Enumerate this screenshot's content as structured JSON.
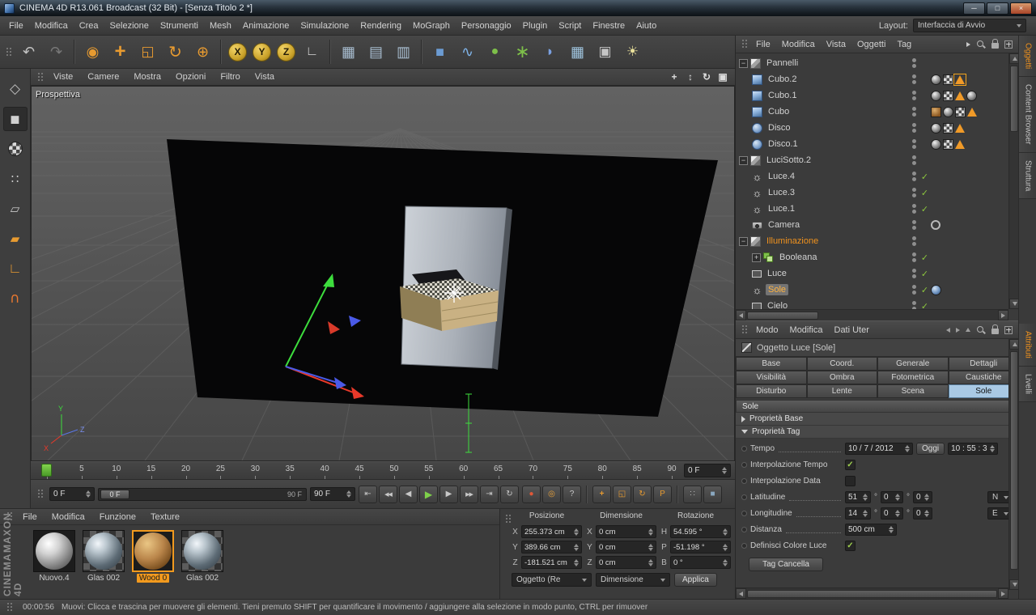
{
  "window": {
    "title": "CINEMA 4D R13.061 Broadcast (32 Bit) - [Senza Titolo 2 *]",
    "minimize": "─",
    "maximize": "□",
    "close": "×"
  },
  "menubar": {
    "items": [
      "File",
      "Modifica",
      "Crea",
      "Selezione",
      "Strumenti",
      "Mesh",
      "Animazione",
      "Simulazione",
      "Rendering",
      "MoGraph",
      "Personaggio",
      "Plugin",
      "Script",
      "Finestre",
      "Aiuto"
    ],
    "layout_label": "Layout:",
    "layout_value": "Interfaccia di Avvio"
  },
  "toolbar": {
    "icons": [
      {
        "name": "undo",
        "glyph": "↶",
        "color": "#c2c2c2",
        "size": 18
      },
      {
        "name": "redo",
        "glyph": "↷",
        "color": "#787878",
        "size": 18
      },
      {
        "sep": true
      },
      {
        "name": "live-selection",
        "glyph": "◉",
        "color": "#e89b30",
        "size": 18
      },
      {
        "name": "move-tool",
        "glyph": "+",
        "color": "#e89b30",
        "size": 24,
        "bold": true
      },
      {
        "name": "scale-tool",
        "glyph": "◱",
        "color": "#e89b30",
        "size": 17
      },
      {
        "name": "rotate-tool",
        "glyph": "↻",
        "color": "#e89b30",
        "size": 20
      },
      {
        "name": "last-tool",
        "glyph": "⊕",
        "color": "#e89b30",
        "size": 18
      },
      {
        "sep": true
      },
      {
        "name": "lock-x-axis",
        "glyph": "X",
        "color": "#241c06",
        "round": true
      },
      {
        "name": "lock-y-axis",
        "glyph": "Y",
        "color": "#241c06",
        "round": true
      },
      {
        "name": "lock-z-axis",
        "glyph": "Z",
        "color": "#241c06",
        "round": true
      },
      {
        "name": "coordinate-system",
        "glyph": "∟",
        "color": "#d8d8d8",
        "size": 16
      },
      {
        "sep": true
      },
      {
        "name": "render-view",
        "glyph": "▦",
        "color": "#a8bdd0",
        "size": 18
      },
      {
        "name": "render-picture-viewer",
        "glyph": "▤",
        "color": "#a8bdd0",
        "size": 18
      },
      {
        "name": "render-settings",
        "glyph": "▥",
        "color": "#a8bdd0",
        "size": 18
      },
      {
        "sep": true
      },
      {
        "name": "add-cube",
        "glyph": "■",
        "color": "#6b9bd2",
        "size": 18
      },
      {
        "name": "add-spline",
        "glyph": "∿",
        "color": "#7fb3e8",
        "size": 18
      },
      {
        "name": "add-generator",
        "glyph": "●",
        "color": "#7ec04a",
        "size": 16
      },
      {
        "name": "add-mograph",
        "glyph": "∗",
        "color": "#7ec04a",
        "size": 22
      },
      {
        "name": "add-deformer",
        "glyph": "◗",
        "color": "#7aa0e0",
        "size": 17
      },
      {
        "name": "add-environment",
        "glyph": "▦",
        "color": "#9fc4de",
        "size": 18
      },
      {
        "name": "add-camera",
        "glyph": "▣",
        "color": "#c4c4c4",
        "size": 17
      },
      {
        "name": "add-light",
        "glyph": "☀",
        "color": "#e8df9a",
        "size": 17
      }
    ]
  },
  "left_toolbar": {
    "icons": [
      {
        "name": "make-editable",
        "glyph": "◇",
        "color": "#c0c0c0",
        "size": 17
      },
      {
        "name": "model-mode",
        "glyph": "◼",
        "color": "#d0d0d0",
        "size": 15,
        "active": true
      },
      {
        "name": "texture-mode",
        "checker": true
      },
      {
        "name": "points-mode",
        "glyph": "∷",
        "color": "#c8c8c8",
        "size": 15
      },
      {
        "name": "edges-mode",
        "glyph": "▱",
        "color": "#c8c8c8",
        "size": 15
      },
      {
        "name": "polygons-mode",
        "glyph": "▰",
        "color": "#e89b30",
        "size": 15
      },
      {
        "name": "axis-mode",
        "glyph": "∟",
        "color": "#e89b30",
        "size": 17
      },
      {
        "name": "snap-tool",
        "glyph": "∪",
        "color": "#e87830",
        "size": 17,
        "rotate": true
      }
    ]
  },
  "viewport": {
    "label": "Prospettiva",
    "menus": [
      "Viste",
      "Camere",
      "Mostra",
      "Opzioni",
      "Filtro",
      "Vista"
    ],
    "nav": [
      {
        "name": "pan-view",
        "glyph": "+"
      },
      {
        "name": "dolly-view",
        "glyph": "↕"
      },
      {
        "name": "orbit-view",
        "glyph": "↻"
      },
      {
        "name": "toggle-view",
        "glyph": "▣"
      }
    ],
    "axis": {
      "x": "X",
      "y": "Y",
      "z": "Z"
    }
  },
  "timeline": {
    "frames": [
      0,
      5,
      10,
      15,
      20,
      25,
      30,
      35,
      40,
      45,
      50,
      55,
      60,
      65,
      70,
      75,
      80,
      85,
      90
    ],
    "current_frame": "0 F"
  },
  "animation": {
    "start_frame": "0 F",
    "slider_handle": "0 F",
    "slider_end": "90 F",
    "end_frame": "90 F",
    "transport": [
      {
        "name": "goto-start",
        "glyph": "⇤"
      },
      {
        "name": "previous-key",
        "glyph": "◀◀",
        "small": true
      },
      {
        "name": "previous-frame",
        "glyph": "◀"
      },
      {
        "name": "play",
        "glyph": "▶",
        "green": true
      },
      {
        "name": "next-frame",
        "glyph": "▶"
      },
      {
        "name": "next-key",
        "glyph": "▶▶",
        "small": true
      },
      {
        "name": "goto-end",
        "glyph": "⇥"
      },
      {
        "name": "loop",
        "glyph": "↻"
      }
    ],
    "keys": [
      {
        "name": "record-keyframe",
        "glyph": "●",
        "color": "#e05838"
      },
      {
        "name": "autokey",
        "glyph": "◎",
        "color": "#e8a13a"
      },
      {
        "name": "keyframe-help",
        "glyph": "?",
        "color": "#c8c8c8"
      },
      {
        "sep": true
      },
      {
        "name": "record-position",
        "glyph": "+",
        "color": "#e89b30",
        "bold": true
      },
      {
        "name": "record-scale",
        "glyph": "◱",
        "color": "#e89b30"
      },
      {
        "name": "record-rotation",
        "glyph": "↻",
        "color": "#e89b30"
      },
      {
        "name": "record-parameter",
        "glyph": "P",
        "color": "#e89b30"
      },
      {
        "sep": true
      },
      {
        "name": "record-pla",
        "glyph": "∷",
        "color": "#b8b8b8"
      },
      {
        "name": "solo-mode",
        "glyph": "■",
        "color": "#8aa8c0"
      }
    ]
  },
  "materials": {
    "menus": [
      "File",
      "Modifica",
      "Funzione",
      "Texture"
    ],
    "items": [
      {
        "name": "Nuovo.4",
        "type": "new"
      },
      {
        "name": "Glas 002",
        "type": "glass"
      },
      {
        "name": "Wood 0",
        "type": "wood",
        "selected": true
      },
      {
        "name": "Glas 002",
        "type": "glass"
      }
    ]
  },
  "branding": {
    "line1": "MAXON",
    "line2": "CINEMA 4D"
  },
  "coordinates": {
    "columns": [
      {
        "header": "Posizione",
        "rows": [
          {
            "axis": "X",
            "value": "255.373 cm"
          },
          {
            "axis": "Y",
            "value": "389.66 cm"
          },
          {
            "axis": "Z",
            "value": "-181.521 cm"
          }
        ]
      },
      {
        "header": "Dimensione",
        "rows": [
          {
            "axis": "X",
            "value": "0 cm"
          },
          {
            "axis": "Y",
            "value": "0 cm"
          },
          {
            "axis": "Z",
            "value": "0 cm"
          }
        ]
      },
      {
        "header": "Rotazione",
        "rows": [
          {
            "axis": "H",
            "value": "54.595 °"
          },
          {
            "axis": "P",
            "value": "-51.198 °"
          },
          {
            "axis": "B",
            "value": "0 °"
          }
        ]
      }
    ],
    "dropdown1": "Oggetto (Re",
    "dropdown2": "Dimensione",
    "apply": "Applica"
  },
  "object_manager": {
    "menus": [
      "File",
      "Modifica",
      "Vista",
      "Oggetti",
      "Tag"
    ],
    "objects": [
      {
        "name": "Pannelli",
        "depth": 0,
        "icon": "null-group",
        "expander": "minus"
      },
      {
        "name": "Cubo.2",
        "depth": 1,
        "icon": "cube",
        "tags": [
          "material",
          "checker",
          "phong"
        ],
        "tag_selected": true
      },
      {
        "name": "Cubo.1",
        "depth": 1,
        "icon": "cube",
        "tags": [
          "material",
          "checker",
          "phong",
          "material"
        ]
      },
      {
        "name": "Cubo",
        "depth": 1,
        "icon": "cube",
        "tags": [
          "wood",
          "material",
          "checker",
          "phong"
        ]
      },
      {
        "name": "Disco",
        "depth": 1,
        "icon": "disc",
        "tags": [
          "material",
          "checker",
          "phong"
        ]
      },
      {
        "name": "Disco.1",
        "depth": 1,
        "icon": "disc",
        "tags": [
          "material",
          "checker",
          "phong"
        ]
      },
      {
        "name": "LuciSotto.2",
        "depth": 0,
        "icon": "null-group",
        "expander": "minus"
      },
      {
        "name": "Luce.4",
        "depth": 1,
        "icon": "light",
        "check": true
      },
      {
        "name": "Luce.3",
        "depth": 1,
        "icon": "light",
        "check": true
      },
      {
        "name": "Luce.1",
        "depth": 1,
        "icon": "light",
        "check": true
      },
      {
        "name": "Camera",
        "depth": 1,
        "icon": "camera",
        "tags": [
          "target"
        ]
      },
      {
        "name": "Illuminazione",
        "depth": 0,
        "icon": "null-group",
        "expander": "minus",
        "orange": true
      },
      {
        "name": "Booleana",
        "depth": 1,
        "icon": "boolean",
        "expander": "plus",
        "check": true
      },
      {
        "name": "Luce",
        "depth": 1,
        "icon": "light-area",
        "check": true
      },
      {
        "name": "Sole",
        "depth": 1,
        "icon": "light",
        "selected": true,
        "check": true,
        "tags": [
          "sun"
        ]
      },
      {
        "name": "Cielo",
        "depth": 1,
        "icon": "light-area",
        "check": true
      }
    ]
  },
  "attributes": {
    "menus": [
      "Modo",
      "Modifica",
      "Dati Uter"
    ],
    "title": "Oggetto Luce [Sole]",
    "tabs": [
      "Base",
      "Coord.",
      "Generale",
      "Dettagli",
      "Visibilità",
      "Ombra",
      "Fotometrica",
      "Caustiche",
      "Disturbo",
      "Lente",
      "Scena",
      "Sole"
    ],
    "selected_tab": "Sole",
    "section": "Sole",
    "groups": [
      "Proprietà Base",
      "Proprietà Tag"
    ],
    "fields": {
      "tempo_label": "Tempo",
      "tempo_date": "10 / 7 / 2012",
      "oggi_button": "Oggi",
      "tempo_time": "10 : 55 : 3",
      "interp_tempo_label": "Interpolazione Tempo",
      "interp_tempo_checked": true,
      "interp_data_label": "Interpolazione Data",
      "interp_data_checked": false,
      "degree": "°",
      "latitudine": {
        "label": "Latitudine",
        "v1": "51",
        "v2": "0",
        "v3": "0",
        "dir": "N"
      },
      "longitudine": {
        "label": "Longitudine",
        "v1": "14",
        "v2": "0",
        "v3": "0",
        "dir": "E"
      },
      "distanza_label": "Distanza",
      "distanza_value": "500 cm",
      "definisci_label": "Definisci Colore Luce",
      "definisci_checked": true,
      "tag_cancella": "Tag Cancella"
    }
  },
  "right_tabs": {
    "top": [
      {
        "label": "Oggetti",
        "active": true
      },
      {
        "label": "Content Browser"
      },
      {
        "label": "Struttura"
      }
    ],
    "bottom": [
      {
        "label": "Attributi",
        "active": true
      },
      {
        "label": "Livelli"
      }
    ]
  },
  "status": {
    "time": "00:00:56",
    "message": "Muovi: Clicca e trascina per muovere gli elementi. Tieni premuto SHIFT per quantificare il movimento / aggiungere alla selezione in modo punto, CTRL per rimuover"
  }
}
